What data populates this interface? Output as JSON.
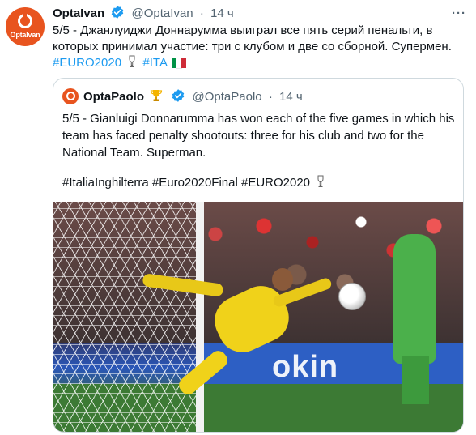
{
  "tweet": {
    "author_name": "OptaIvan",
    "author_handle": "@OptaIvan",
    "separator": "·",
    "time": "14 ч",
    "avatar_brand": "OptaIvan",
    "text": "5/5 - Джанлуиджи Доннарумма выиграл все пять серий пенальти, в которых принимал участие: три с клубом и две со сборной. Супермен.",
    "hashtags": [
      "#EURO2020",
      "#ITA"
    ],
    "more_label": "···"
  },
  "quoted": {
    "author_name": "OptaPaolo",
    "author_handle": "@OptaPaolo",
    "separator": "·",
    "time": "14 ч",
    "text": "5/5 - Gianluigi Donnarumma has won each of the five games in which his team has faced penalty shootouts: three for his club and two for the National Team. Superman.",
    "tags_line": "#ItaliaInghilterra #Euro2020Final #EURO2020",
    "photo_board_text": "okin",
    "photo_description_icon": "goalkeeper-save-photo"
  },
  "colors": {
    "brand_orange": "#e8541f",
    "link_blue": "#1d9bf0",
    "verified_blue": "#1d9bf0",
    "muted_gray": "#536471",
    "border_gray": "#cfd9de",
    "flag_green": "#009246",
    "flag_white": "#ffffff",
    "flag_red": "#ce2b37"
  },
  "icons": {
    "verified": "verified-badge-icon",
    "trophy_small": "trophy-icon",
    "more": "more-options-icon",
    "flag_italy": "italy-flag-icon",
    "quote_trophy": "gold-trophy-icon"
  }
}
